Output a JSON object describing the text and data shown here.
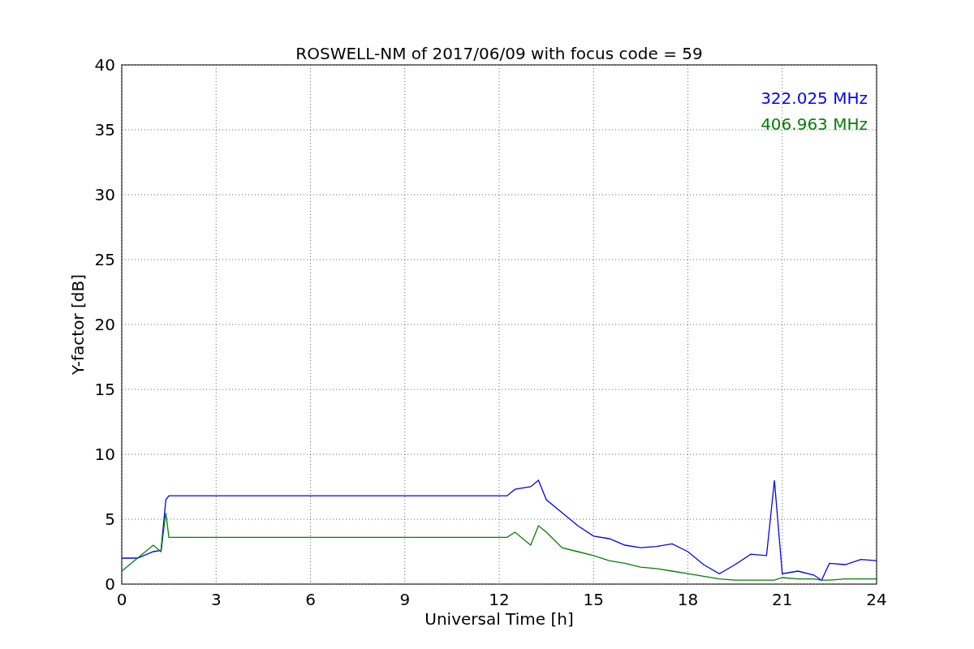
{
  "figure": {
    "chart_data": {
      "type": "line",
      "title": "ROSWELL-NM of 2017/06/09 with focus code = 59",
      "xlabel": "Universal Time [h]",
      "ylabel": "Y-factor [dB]",
      "x": [
        0,
        0.5,
        1,
        1.25,
        1.4,
        1.5,
        12.25,
        12.5,
        13,
        13.25,
        13.5,
        14,
        14.5,
        15,
        15.5,
        16,
        16.5,
        17,
        17.5,
        18,
        18.5,
        19,
        19.5,
        20,
        20.5,
        20.75,
        21,
        21.5,
        22,
        22.25,
        22.5,
        23,
        23.5,
        24
      ],
      "series": [
        {
          "name": "322.025 MHz",
          "color": "#0000ff",
          "values": [
            2,
            2,
            2.5,
            2.6,
            6.5,
            6.8,
            6.8,
            7.3,
            7.5,
            8,
            6.5,
            5.5,
            4.5,
            3.7,
            3.5,
            3,
            2.8,
            2.9,
            3.1,
            2.5,
            1.5,
            0.8,
            1.5,
            2.3,
            2.2,
            8,
            0.8,
            1,
            0.7,
            0.3,
            1.6,
            1.5,
            1.9,
            1.8
          ]
        },
        {
          "name": "406.963 MHz",
          "color": "#008000",
          "values": [
            1,
            2,
            3,
            2.5,
            5.5,
            3.6,
            3.6,
            4,
            3,
            4.5,
            4,
            2.8,
            2.5,
            2.2,
            1.8,
            1.6,
            1.3,
            1.2,
            1,
            0.8,
            0.6,
            0.4,
            0.3,
            0.3,
            0.3,
            0.3,
            0.5,
            0.4,
            0.4,
            0.3,
            0.3,
            0.4,
            0.4,
            0.4
          ]
        }
      ],
      "xlim": [
        0,
        24
      ],
      "ylim": [
        0,
        40
      ],
      "xticks": [
        0,
        3,
        6,
        9,
        12,
        15,
        18,
        21,
        24
      ],
      "yticks": [
        0,
        5,
        10,
        15,
        20,
        25,
        30,
        35,
        40
      ],
      "grid": true
    }
  }
}
